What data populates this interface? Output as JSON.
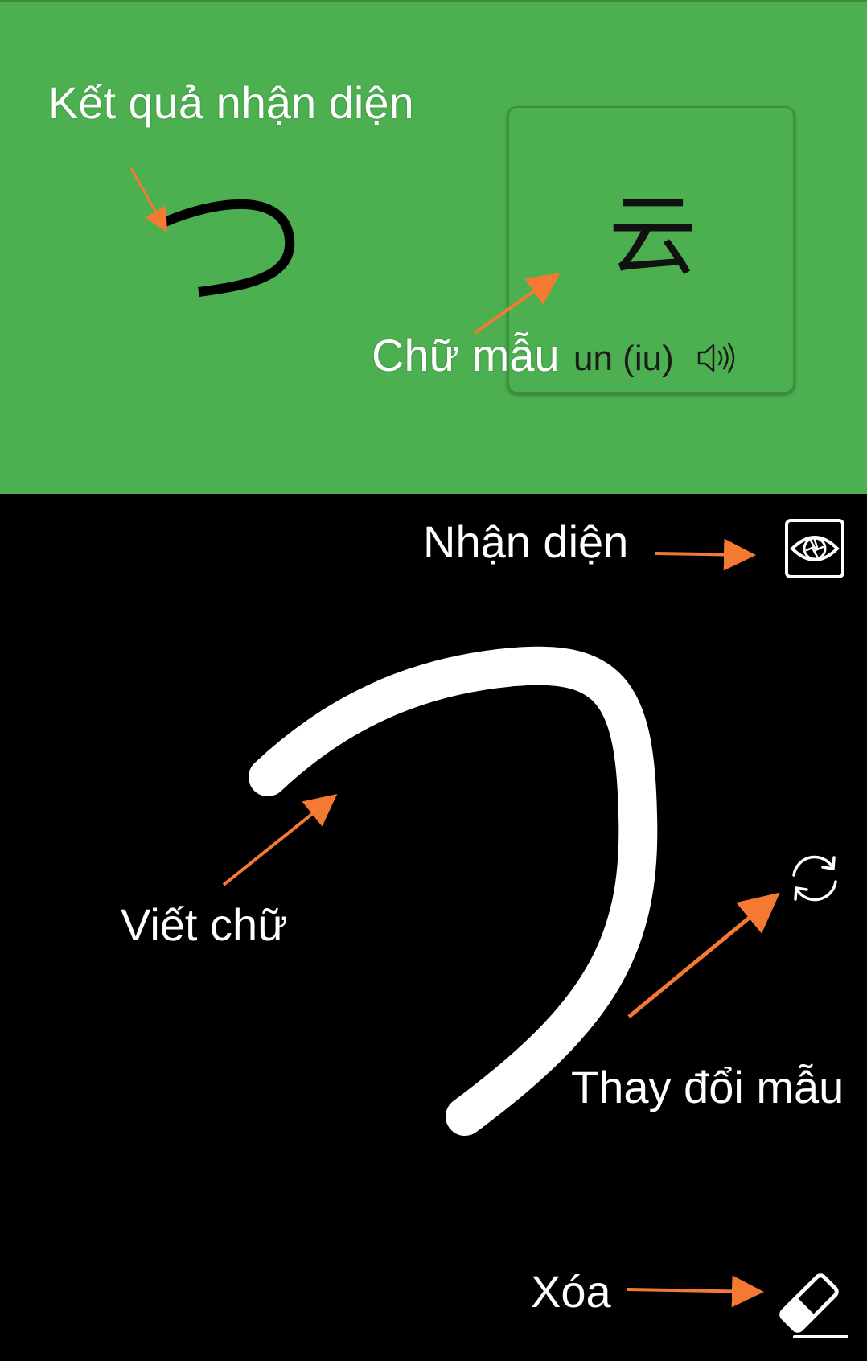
{
  "result_panel": {
    "recognized_char_icon": "hiragana-tsu-stroke",
    "sample_card": {
      "character": "云",
      "reading": "un (iu)",
      "speaker_icon": "speaker-icon"
    }
  },
  "drawing_area": {
    "stroke_icon": "user-drawn-stroke",
    "tools": {
      "recognize_icon": "eye-icon",
      "change_sample_icon": "refresh-icon",
      "erase_icon": "eraser-icon"
    }
  },
  "annotations": {
    "recognition_result": "Kết quả nhận diện",
    "sample_character": "Chữ mẫu",
    "recognize": "Nhận diện",
    "write_character": "Viết chữ",
    "change_sample": "Thay đổi mẫu",
    "erase": "Xóa"
  },
  "colors": {
    "panel_green": "#4caf50",
    "arrow_orange": "#f47a33",
    "canvas_black": "#000000",
    "stroke_white": "#ffffff"
  }
}
